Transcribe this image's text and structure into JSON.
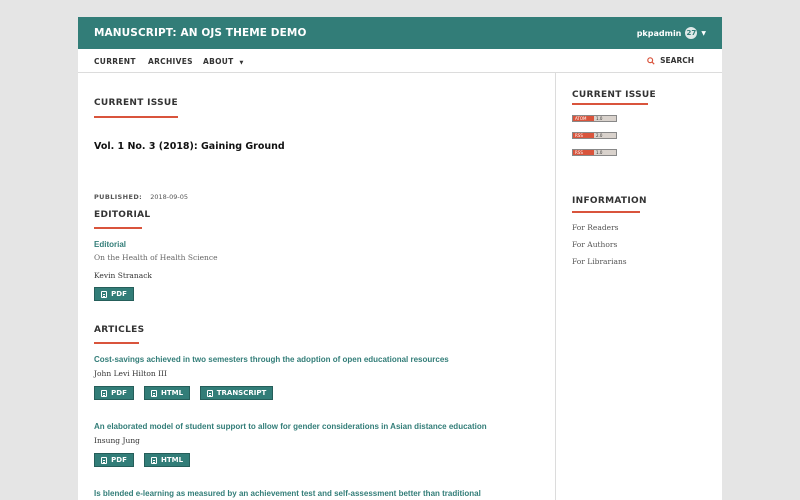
{
  "header": {
    "site_title": "MANUSCRIPT: AN OJS THEME DEMO",
    "username": "pkpadmin",
    "notification_count": "27"
  },
  "nav": {
    "items": [
      "CURRENT",
      "ARCHIVES",
      "ABOUT"
    ],
    "search_label": "SEARCH"
  },
  "main": {
    "current_issue_heading": "CURRENT ISSUE",
    "issue_title": "Vol. 1 No. 3 (2018): Gaining Ground",
    "published_label": "PUBLISHED:",
    "published_date": "2018-09-05",
    "editorial_heading": "EDITORIAL",
    "editorial": {
      "title": "Editorial",
      "subtitle": "On the Health of Health Science",
      "author": "Kevin Stranack",
      "buttons": [
        "PDF"
      ]
    },
    "articles_heading": "ARTICLES",
    "articles": [
      {
        "title": "Cost-savings achieved in two semesters through the adoption of open educational resources",
        "author": "John Levi Hilton III",
        "buttons": [
          "PDF",
          "HTML",
          "TRANSCRIPT"
        ]
      },
      {
        "title": "An elaborated model of student support to allow for gender considerations in Asian distance education",
        "author": "Insung Jung",
        "buttons": [
          "PDF",
          "HTML"
        ]
      },
      {
        "title": "Is blended e-learning as measured by an achievement test and self-assessment better than traditional"
      }
    ]
  },
  "sidebar": {
    "current_issue_heading": "CURRENT ISSUE",
    "feeds": [
      {
        "left": "ATOM",
        "right": "1.0"
      },
      {
        "left": "RSS",
        "right": "2.0"
      },
      {
        "left": "RSS",
        "right": "1.0"
      }
    ],
    "information_heading": "INFORMATION",
    "information_links": [
      "For Readers",
      "For Authors",
      "For Librarians"
    ]
  },
  "colors": {
    "brand": "#327d78",
    "accent": "#d9543c"
  }
}
